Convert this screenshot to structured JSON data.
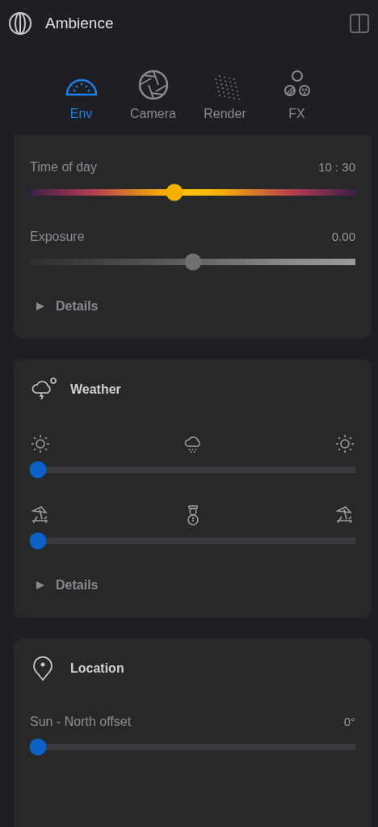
{
  "header": {
    "title": "Ambience"
  },
  "tabs": [
    {
      "label": "Env",
      "selected": true,
      "kind": "env"
    },
    {
      "label": "Camera",
      "selected": false,
      "kind": "camera"
    },
    {
      "label": "Render",
      "selected": false,
      "kind": "render"
    },
    {
      "label": "FX",
      "selected": false,
      "kind": "fx"
    }
  ],
  "sections": [
    {
      "kind": "cut",
      "sliders": [
        {
          "kind": "time",
          "label": "Time of day",
          "reading": "10 : 30",
          "level": 0.44
        },
        {
          "kind": "exposure",
          "label": "Exposure",
          "reading": "0.00",
          "level": 0.5
        }
      ],
      "details": {
        "label": "Details",
        "expanded": false
      }
    },
    {
      "kind": "weather",
      "title": "Weather",
      "sliders": [
        {
          "kind": "sky",
          "level": 0
        },
        {
          "kind": "season",
          "level": 0
        }
      ],
      "details": {
        "label": "Details",
        "expanded": false
      }
    },
    {
      "kind": "location",
      "title": "Location",
      "sliders": [
        {
          "kind": "plain",
          "label": "Sun - North offset",
          "reading": "0°",
          "level": 0
        }
      ]
    }
  ]
}
